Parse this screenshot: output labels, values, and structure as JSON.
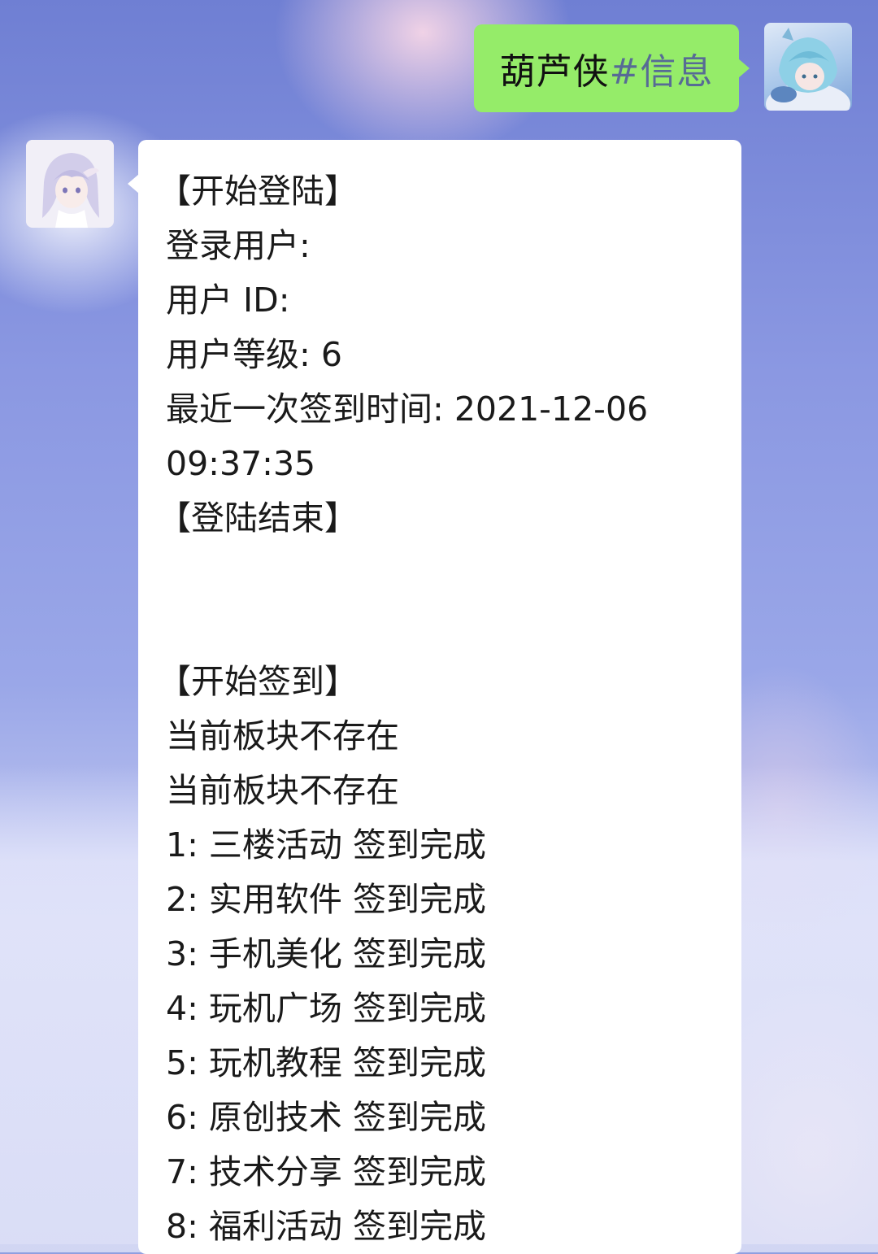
{
  "colors": {
    "sent_bubble": "#95ec69",
    "received_bubble": "#ffffff",
    "hash_link": "#576b95"
  },
  "chat": {
    "sent": {
      "avatar": "avatar-icon",
      "prefix": "葫芦侠",
      "tag": "#信息"
    },
    "received": {
      "avatar": "avatar-icon",
      "login": {
        "start": "【开始登陆】",
        "user_label": "登录用户:",
        "id_label": "用户 ID:",
        "level_label": "用户等级: 6",
        "last_signin": "最近一次签到时间: 2021-12-06",
        "last_signin_time": "09:37:35",
        "end": "【登陆结束】"
      },
      "signin": {
        "start": "【开始签到】",
        "lines": [
          "当前板块不存在",
          "当前板块不存在",
          "1: 三楼活动 签到完成",
          "2: 实用软件 签到完成",
          "3: 手机美化 签到完成",
          "4: 玩机广场 签到完成",
          "5: 玩机教程 签到完成",
          "6: 原创技术 签到完成",
          "7: 技术分享 签到完成",
          "8: 福利活动 签到完成"
        ]
      }
    }
  }
}
